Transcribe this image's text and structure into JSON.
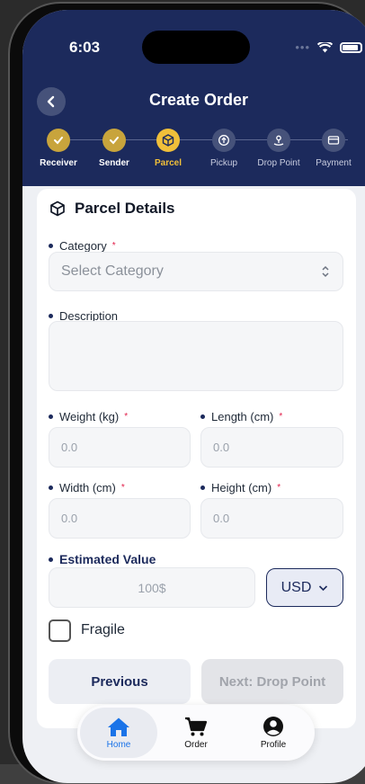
{
  "status_bar": {
    "time": "6:03",
    "dots": "•••"
  },
  "header": {
    "title": "Create Order"
  },
  "steps": [
    {
      "label": "Receiver",
      "state": "done"
    },
    {
      "label": "Sender",
      "state": "done"
    },
    {
      "label": "Parcel",
      "state": "active"
    },
    {
      "label": "Pickup",
      "state": "todo"
    },
    {
      "label": "Drop Point",
      "state": "todo"
    },
    {
      "label": "Payment",
      "state": "todo"
    }
  ],
  "form": {
    "section_title": "Parcel Details",
    "required_mark": "*",
    "category": {
      "label": "Category",
      "placeholder": "Select Category"
    },
    "description": {
      "label": "Description",
      "value": ""
    },
    "weight": {
      "label": "Weight (kg)",
      "placeholder": "0.0"
    },
    "length": {
      "label": "Length (cm)",
      "placeholder": "0.0"
    },
    "width": {
      "label": "Width (cm)",
      "placeholder": "0.0"
    },
    "height": {
      "label": "Height (cm)",
      "placeholder": "0.0"
    },
    "estimated_value": {
      "label": "Estimated Value",
      "placeholder": "100$"
    },
    "currency": {
      "selected": "USD"
    },
    "fragile": {
      "label": "Fragile",
      "checked": false
    }
  },
  "buttons": {
    "previous": "Previous",
    "next": "Next: Drop Point"
  },
  "tabbar": [
    {
      "label": "Home",
      "active": true
    },
    {
      "label": "Order",
      "active": false
    },
    {
      "label": "Profile",
      "active": false
    }
  ],
  "colors": {
    "header_bg": "#1c2a5c",
    "step_active": "#f0bf3a",
    "step_done": "#c8a43c",
    "tab_active": "#1a73e8",
    "required": "#e11d48"
  }
}
